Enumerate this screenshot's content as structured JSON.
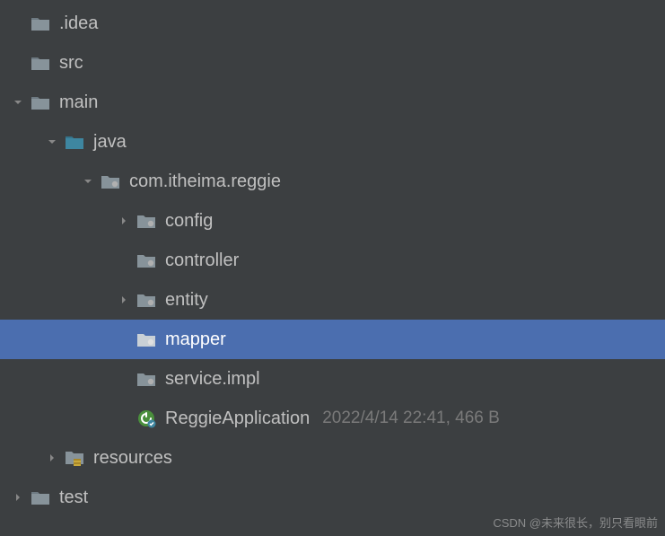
{
  "tree": {
    "idea": ".idea",
    "src": "src",
    "main": "main",
    "java": "java",
    "package": "com.itheima.reggie",
    "config": "config",
    "controller": "controller",
    "entity": "entity",
    "mapper": "mapper",
    "serviceimpl": "service.impl",
    "reggieapp": "ReggieApplication",
    "reggieapp_meta": "2022/4/14 22:41, 466 B",
    "resources": "resources",
    "test": "test"
  },
  "watermark": "CSDN @未来很长，别只看眼前"
}
